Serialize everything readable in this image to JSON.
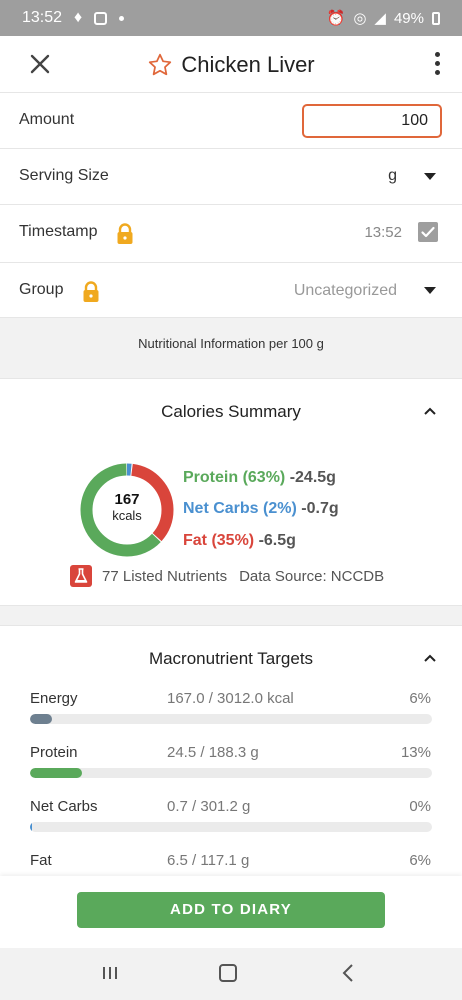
{
  "status_bar": {
    "time": "13:52",
    "battery": "49%"
  },
  "header": {
    "title": "Chicken Liver"
  },
  "form": {
    "amount_label": "Amount",
    "amount_value": "100",
    "serving_label": "Serving Size",
    "serving_value": "g",
    "timestamp_label": "Timestamp",
    "timestamp_value": "13:52",
    "group_label": "Group",
    "group_value": "Uncategorized"
  },
  "nutrition_info": "Nutritional Information per 100 g",
  "calories_summary": {
    "title": "Calories Summary",
    "kcals": "167",
    "kcals_unit": "kcals",
    "protein_label": "Protein (63%)",
    "protein_value": "-24.5g",
    "carbs_label": "Net Carbs (2%)",
    "carbs_value": "-0.7g",
    "fat_label": "Fat (35%)",
    "fat_value": "-6.5g",
    "listed_nutrients": "77 Listed Nutrients",
    "data_source": "Data Source: NCCDB"
  },
  "chart_data": {
    "type": "pie",
    "categories": [
      "Protein",
      "Net Carbs",
      "Fat"
    ],
    "values": [
      63,
      2,
      35
    ],
    "colors": [
      "#5aa95b",
      "#4a90d0",
      "#d9453b"
    ]
  },
  "targets": {
    "title": "Macronutrient Targets",
    "items": [
      {
        "label": "Energy",
        "value": "167.0 / 3012.0 kcal",
        "pct": "6%",
        "fraction": 0.055,
        "color": "#6e8090"
      },
      {
        "label": "Protein",
        "value": "24.5 / 188.3 g",
        "pct": "13%",
        "fraction": 0.13,
        "color": "#5aa95b"
      },
      {
        "label": "Net Carbs",
        "value": "0.7 / 301.2 g",
        "pct": "0%",
        "fraction": 0.005,
        "color": "#4a90d0"
      },
      {
        "label": "Fat",
        "value": "6.5 / 117.1 g",
        "pct": "6%",
        "fraction": 0.055,
        "color": "#d9453b"
      }
    ]
  },
  "add_button": "ADD TO DIARY",
  "colors": {
    "accent": "#e0673a",
    "green": "#5aa95b",
    "blue": "#4a90d0",
    "red": "#d9453b",
    "lock": "#f0a91f"
  }
}
